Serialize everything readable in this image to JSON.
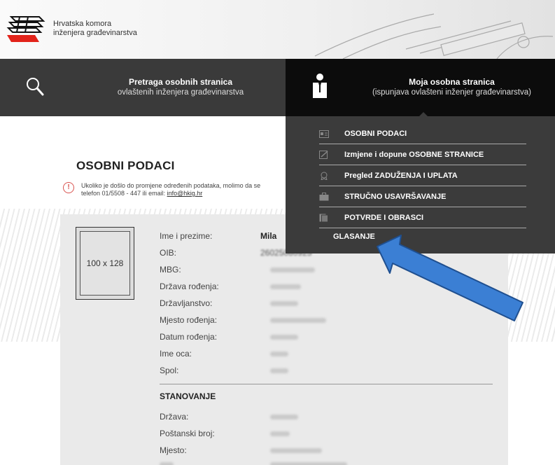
{
  "header": {
    "org_line1": "Hrvatska komora",
    "org_line2": "inženjera građevinarstva"
  },
  "nav": {
    "search_title": "Pretraga osobnih stranica",
    "search_sub": "ovlaštenih inženjera građevinarstva",
    "my_title": "Moja osobna stranica",
    "my_sub": "(ispunjava ovlašteni inženjer građevinarstva)"
  },
  "dropdown": {
    "items": [
      {
        "label": "OSOBNI PODACI",
        "icon": "id-card-icon"
      },
      {
        "label": "Izmjene i dopune OSOBNE STRANICE",
        "icon": "edit-icon"
      },
      {
        "label": "Pregled ZADUŽENJA I UPLATA",
        "icon": "badge-icon"
      },
      {
        "label": "STRUČNO USAVRŠAVANJE",
        "icon": "briefcase-icon"
      },
      {
        "label": "POTVRDE I OBRASCI",
        "icon": "documents-icon"
      }
    ],
    "last": "GLASANJE"
  },
  "page": {
    "title": "OSOBNI PODACI",
    "notice_line1": "Ukoliko je došlo do promjene određenih podataka, molimo da se",
    "notice_line2": "telefon 01/5508 - 447 ili email: ",
    "notice_email": "info@hkig.hr"
  },
  "profile": {
    "photo_placeholder": "100 x 128",
    "fields": [
      {
        "label": "Ime i prezime:",
        "value": "Mila"
      },
      {
        "label": "OIB:",
        "value": "26025080925"
      },
      {
        "label": "MBG:",
        "value": ""
      },
      {
        "label": "Država rođenja:",
        "value": ""
      },
      {
        "label": "Državljanstvo:",
        "value": ""
      },
      {
        "label": "Mjesto rođenja:",
        "value": ""
      },
      {
        "label": "Datum rođenja:",
        "value": ""
      },
      {
        "label": "Ime oca:",
        "value": ""
      },
      {
        "label": "Spol:",
        "value": ""
      }
    ],
    "section_title": "STANOVANJE",
    "address_fields": [
      {
        "label": "Država:",
        "value": ""
      },
      {
        "label": "Poštanski broj:",
        "value": ""
      },
      {
        "label": "Mjesto:",
        "value": ""
      }
    ]
  },
  "colors": {
    "nav_dark": "#3a3a3a",
    "nav_active": "#0c0c0c",
    "notice_red": "#d9534f",
    "annotation_arrow": "#3b7fd4"
  }
}
